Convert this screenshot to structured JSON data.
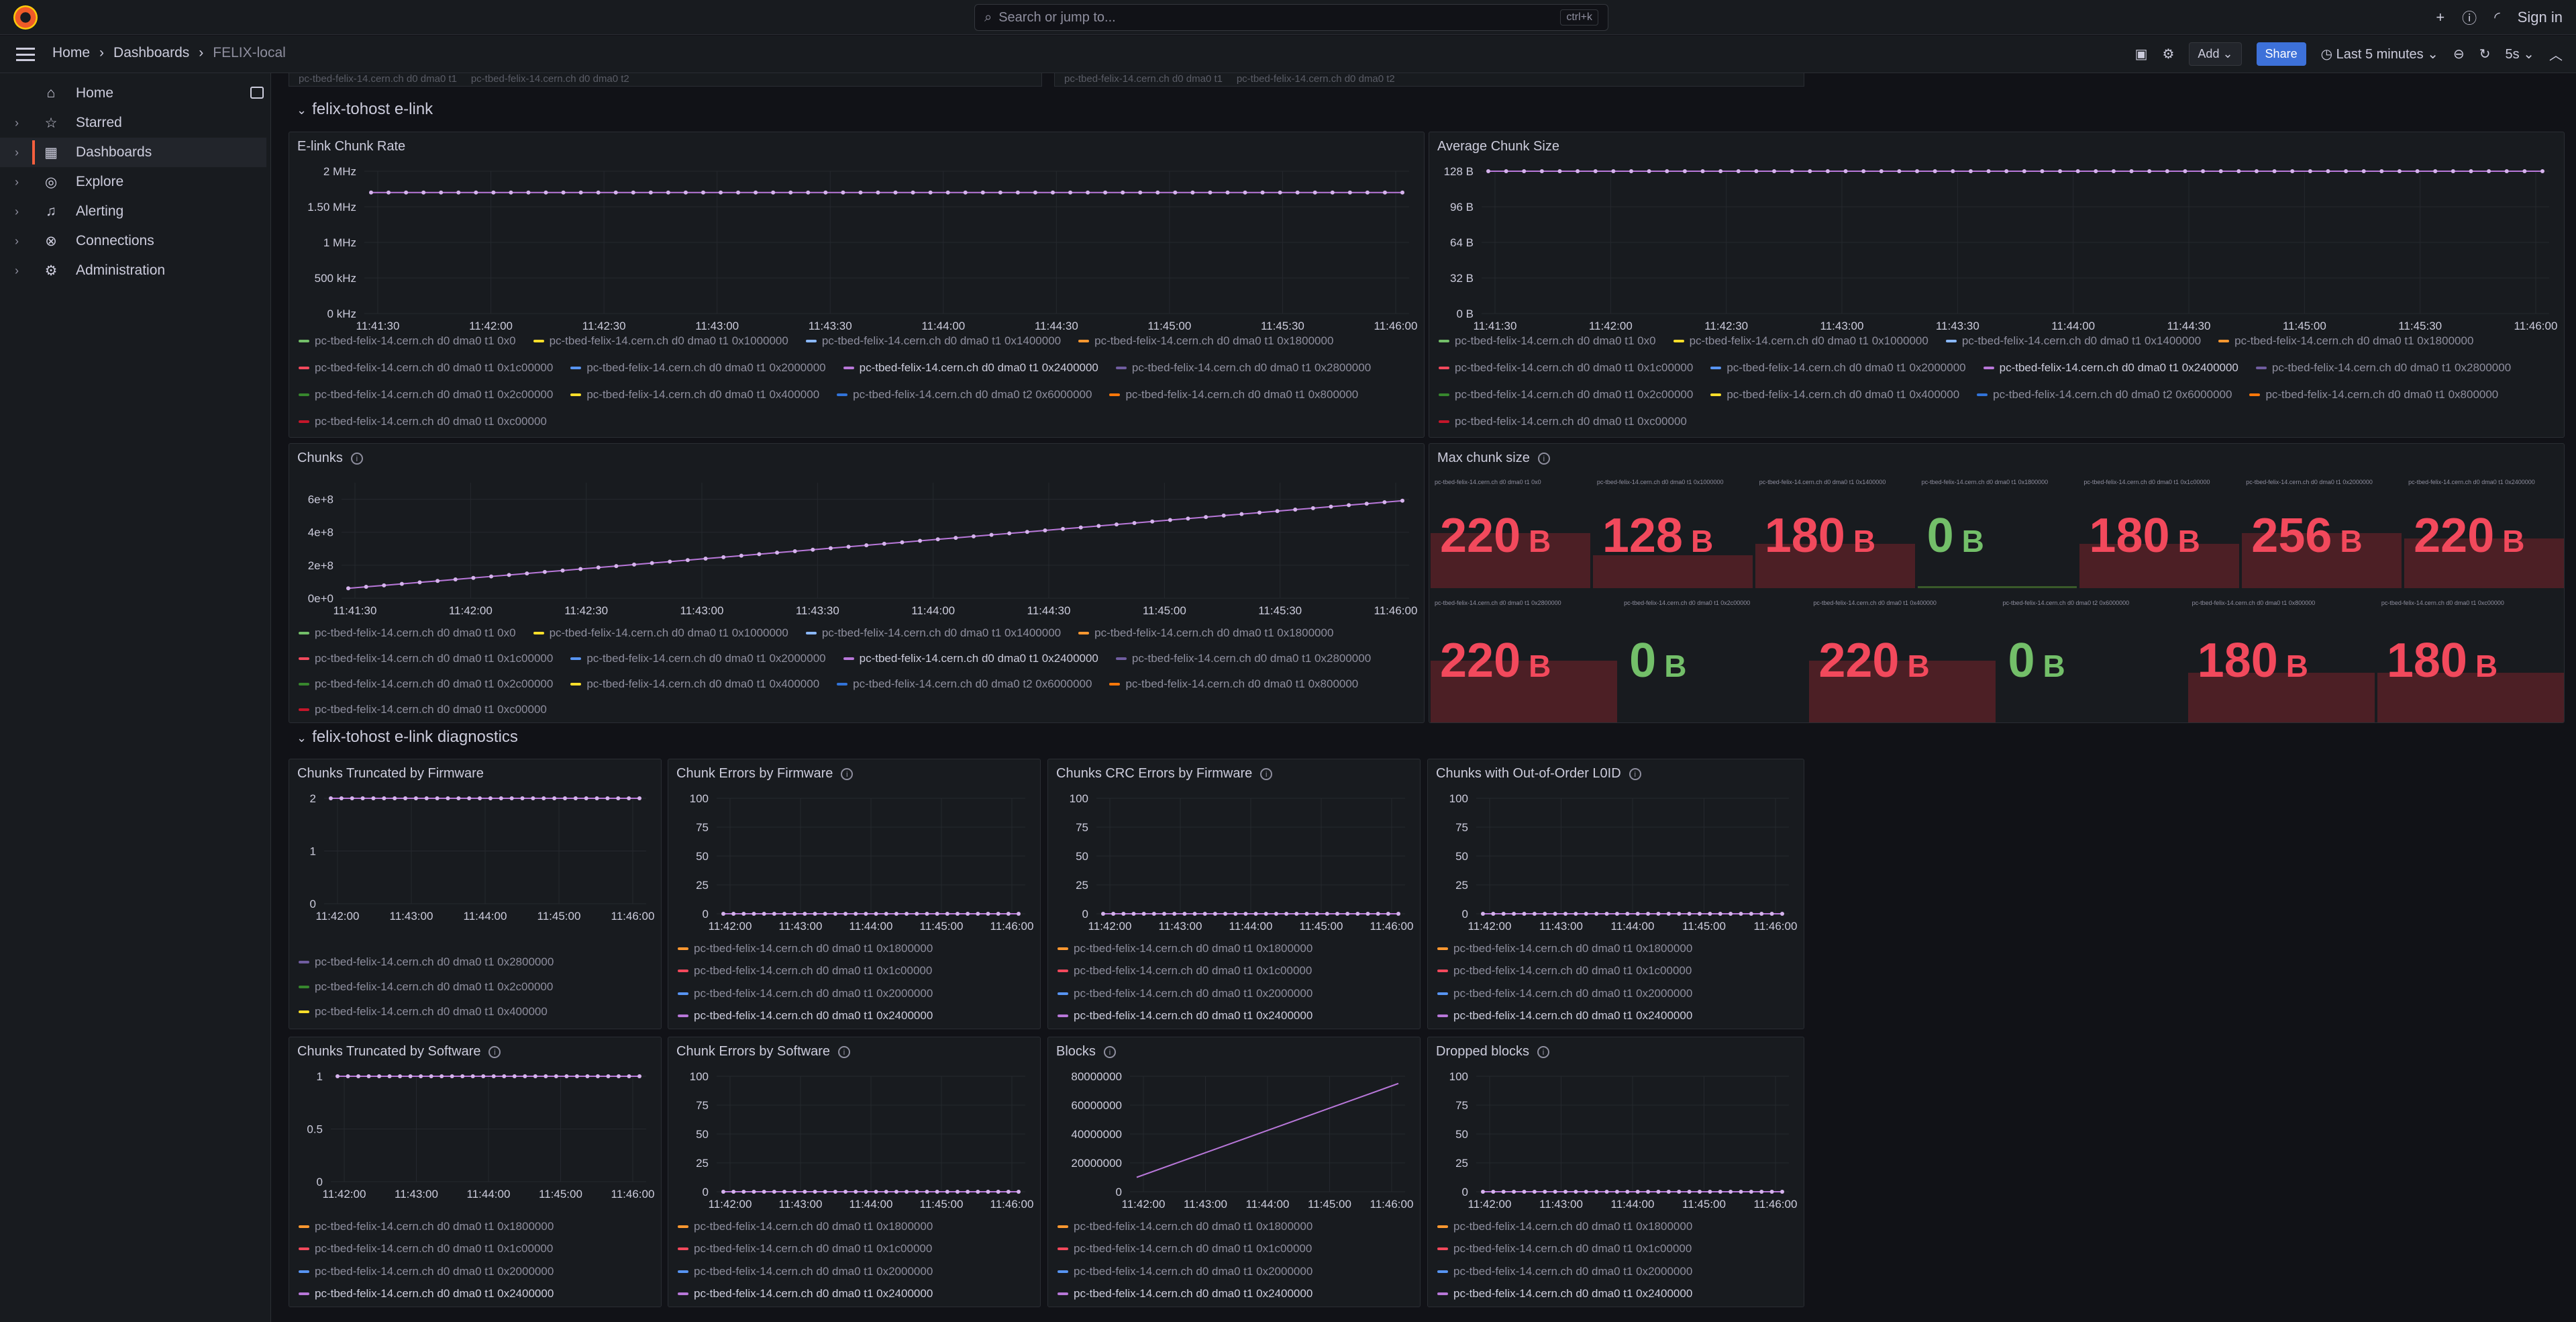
{
  "app": {
    "search_placeholder": "Search or jump to...",
    "search_shortcut": "ctrl+k",
    "plus": "+",
    "sign_in": "Sign in"
  },
  "breadcrumb": [
    "Home",
    "Dashboards",
    "FELIX-local"
  ],
  "nav": {
    "add": "Add",
    "share": "Share",
    "time_range": "Last 5 minutes",
    "refresh": "5s"
  },
  "sidebar": [
    {
      "label": "Home",
      "icon": "home-icon",
      "glyph": "⌂",
      "chev": false,
      "active": false
    },
    {
      "label": "Starred",
      "icon": "star-icon",
      "glyph": "☆",
      "chev": true,
      "active": false
    },
    {
      "label": "Dashboards",
      "icon": "dashboards-icon",
      "glyph": "▦",
      "chev": true,
      "active": true
    },
    {
      "label": "Explore",
      "icon": "compass-icon",
      "glyph": "◎",
      "chev": true,
      "active": false
    },
    {
      "label": "Alerting",
      "icon": "bell-icon",
      "glyph": "♫",
      "chev": true,
      "active": false
    },
    {
      "label": "Connections",
      "icon": "connections-icon",
      "glyph": "⊗",
      "chev": true,
      "active": false
    },
    {
      "label": "Administration",
      "icon": "gear-icon",
      "glyph": "⚙",
      "chev": true,
      "active": false
    }
  ],
  "top_stub": [
    "pc-tbed-felix-14.cern.ch d0 dma0 t1",
    "pc-tbed-felix-14.cern.ch d0 dma0 t2"
  ],
  "rows": {
    "elink": "felix-tohost e-link",
    "diag": "felix-tohost e-link diagnostics"
  },
  "colors": [
    "#73bf69",
    "#fade2a",
    "#8ab8ff",
    "#ff9830",
    "#f2495c",
    "#5794f2",
    "#b877d9",
    "#705da0",
    "#37872d",
    "#fade2a",
    "#3274d9",
    "#ff780a",
    "#c4162a",
    "#c8a1f2"
  ],
  "legend_full": [
    {
      "label": "pc-tbed-felix-14.cern.ch d0 dma0 t1 0x0",
      "color": "#73bf69",
      "hl": false
    },
    {
      "label": "pc-tbed-felix-14.cern.ch d0 dma0 t1 0x1000000",
      "color": "#fade2a",
      "hl": false
    },
    {
      "label": "pc-tbed-felix-14.cern.ch d0 dma0 t1 0x1400000",
      "color": "#8ab8ff",
      "hl": false
    },
    {
      "label": "pc-tbed-felix-14.cern.ch d0 dma0 t1 0x1800000",
      "color": "#ff9830",
      "hl": false
    },
    {
      "label": "pc-tbed-felix-14.cern.ch d0 dma0 t1 0x1c00000",
      "color": "#f2495c",
      "hl": false
    },
    {
      "label": "pc-tbed-felix-14.cern.ch d0 dma0 t1 0x2000000",
      "color": "#5794f2",
      "hl": false
    },
    {
      "label": "pc-tbed-felix-14.cern.ch d0 dma0 t1 0x2400000",
      "color": "#b877d9",
      "hl": true
    },
    {
      "label": "pc-tbed-felix-14.cern.ch d0 dma0 t1 0x2800000",
      "color": "#705da0",
      "hl": false
    },
    {
      "label": "pc-tbed-felix-14.cern.ch d0 dma0 t1 0x2c00000",
      "color": "#37872d",
      "hl": false
    },
    {
      "label": "pc-tbed-felix-14.cern.ch d0 dma0 t1 0x400000",
      "color": "#fade2a",
      "hl": false
    },
    {
      "label": "pc-tbed-felix-14.cern.ch d0 dma0 t2 0x6000000",
      "color": "#3274d9",
      "hl": false
    },
    {
      "label": "pc-tbed-felix-14.cern.ch d0 dma0 t1 0x800000",
      "color": "#ff780a",
      "hl": false
    },
    {
      "label": "pc-tbed-felix-14.cern.ch d0 dma0 t1 0xc00000",
      "color": "#c4162a",
      "hl": false
    }
  ],
  "legend_diag": [
    {
      "label": "pc-tbed-felix-14.cern.ch d0 dma0 t1 0x1800000",
      "color": "#ff9830",
      "hl": false
    },
    {
      "label": "pc-tbed-felix-14.cern.ch d0 dma0 t1 0x1c00000",
      "color": "#f2495c",
      "hl": false
    },
    {
      "label": "pc-tbed-felix-14.cern.ch d0 dma0 t1 0x2000000",
      "color": "#5794f2",
      "hl": false
    },
    {
      "label": "pc-tbed-felix-14.cern.ch d0 dma0 t1 0x2400000",
      "color": "#b877d9",
      "hl": true
    }
  ],
  "legend_trunc_fw": [
    {
      "label": "pc-tbed-felix-14.cern.ch d0 dma0 t1 0x2800000",
      "color": "#705da0",
      "hl": false
    },
    {
      "label": "pc-tbed-felix-14.cern.ch d0 dma0 t1 0x2c00000",
      "color": "#37872d",
      "hl": false
    },
    {
      "label": "pc-tbed-felix-14.cern.ch d0 dma0 t1 0x400000",
      "color": "#fade2a",
      "hl": false
    }
  ],
  "max_chunk": {
    "title": "Max chunk size",
    "row1": [
      {
        "label": "pc-tbed-felix-14.cern.ch d0 dma0 t1 0x0",
        "value": "220",
        "unit": "B",
        "status": "red",
        "fill": 0.5
      },
      {
        "label": "pc-tbed-felix-14.cern.ch d0 dma0 t1 0x1000000",
        "value": "128",
        "unit": "B",
        "status": "red",
        "fill": 0.3
      },
      {
        "label": "pc-tbed-felix-14.cern.ch d0 dma0 t1 0x1400000",
        "value": "180",
        "unit": "B",
        "status": "red",
        "fill": 0.4
      },
      {
        "label": "pc-tbed-felix-14.cern.ch d0 dma0 t1 0x1800000",
        "value": "0",
        "unit": "B",
        "status": "green",
        "fill": 0.02
      },
      {
        "label": "pc-tbed-felix-14.cern.ch d0 dma0 t1 0x1c00000",
        "value": "180",
        "unit": "B",
        "status": "red",
        "fill": 0.4
      },
      {
        "label": "pc-tbed-felix-14.cern.ch d0 dma0 t1 0x2000000",
        "value": "256",
        "unit": "B",
        "status": "red",
        "fill": 0.5
      },
      {
        "label": "pc-tbed-felix-14.cern.ch d0 dma0 t1 0x2400000",
        "value": "220",
        "unit": "B",
        "status": "red",
        "fill": 0.45
      }
    ],
    "row2": [
      {
        "label": "pc-tbed-felix-14.cern.ch d0 dma0 t1 0x2800000",
        "value": "220",
        "unit": "B",
        "status": "red",
        "fill": 0.5
      },
      {
        "label": "pc-tbed-felix-14.cern.ch d0 dma0 t1 0x2c00000",
        "value": "0",
        "unit": "B",
        "status": "green",
        "fill": 0.0
      },
      {
        "label": "pc-tbed-felix-14.cern.ch d0 dma0 t1 0x400000",
        "value": "220",
        "unit": "B",
        "status": "red",
        "fill": 0.5
      },
      {
        "label": "pc-tbed-felix-14.cern.ch d0 dma0 t2 0x6000000",
        "value": "0",
        "unit": "B",
        "status": "green",
        "fill": 0.0
      },
      {
        "label": "pc-tbed-felix-14.cern.ch d0 dma0 t1 0x800000",
        "value": "180",
        "unit": "B",
        "status": "red",
        "fill": 0.4
      },
      {
        "label": "pc-tbed-felix-14.cern.ch d0 dma0 t1 0xc00000",
        "value": "180",
        "unit": "B",
        "status": "red",
        "fill": 0.4
      }
    ]
  },
  "chart_data": [
    {
      "id": "elink_rate",
      "title": "E-link Chunk Rate",
      "type": "line",
      "ytick": [
        "0 kHz",
        "500 kHz",
        "1 MHz",
        "1.50 MHz",
        "2 MHz"
      ],
      "ylim": [
        0,
        2000000
      ],
      "ytick_values": [
        0,
        500000,
        1000000,
        1500000,
        2000000
      ],
      "xtick": [
        "11:41:30",
        "11:42:00",
        "11:42:30",
        "11:43:00",
        "11:43:30",
        "11:44:00",
        "11:44:30",
        "11:45:00",
        "11:45:30",
        "11:46:00"
      ],
      "series": [
        {
          "color": "#b877d9",
          "values": [
            1700000,
            1700000,
            1700000,
            1700000,
            1700000,
            1700000,
            1700000,
            1700000,
            1700000,
            1700000,
            1700000,
            1700000,
            1700000,
            1700000,
            1700000,
            1700000,
            1700000,
            1700000,
            1700000,
            1700000,
            1700000,
            1700000,
            1700000,
            1700000,
            1700000,
            1700000,
            1700000,
            1700000,
            1700000,
            1700000,
            1700000,
            1700000,
            1700000,
            1700000,
            1700000,
            1700000,
            1700000,
            1700000,
            1700000,
            1700000,
            1700000,
            1700000,
            1700000,
            1700000,
            1700000,
            1700000,
            1700000,
            1700000,
            1700000,
            1700000,
            1700000,
            1700000,
            1700000,
            1700000,
            1700000,
            1700000,
            1700000,
            1700000,
            1700000,
            1700000
          ]
        }
      ]
    },
    {
      "id": "avg_chunk",
      "title": "Average Chunk Size",
      "type": "line",
      "ytick": [
        "0 B",
        "32 B",
        "64 B",
        "96 B",
        "128 B"
      ],
      "ylim": [
        0,
        128
      ],
      "ytick_values": [
        0,
        32,
        64,
        96,
        128
      ],
      "xtick": [
        "11:41:30",
        "11:42:00",
        "11:42:30",
        "11:43:00",
        "11:43:30",
        "11:44:00",
        "11:44:30",
        "11:45:00",
        "11:45:30",
        "11:46:00"
      ],
      "series": [
        {
          "color": "#b877d9",
          "values": [
            128,
            128,
            128,
            128,
            128,
            128,
            128,
            128,
            128,
            128,
            128,
            128,
            128,
            128,
            128,
            128,
            128,
            128,
            128,
            128,
            128,
            128,
            128,
            128,
            128,
            128,
            128,
            128,
            128,
            128,
            128,
            128,
            128,
            128,
            128,
            128,
            128,
            128,
            128,
            128,
            128,
            128,
            128,
            128,
            128,
            128,
            128,
            128,
            128,
            128,
            128,
            128,
            128,
            128,
            128,
            128,
            128,
            128,
            128,
            128
          ]
        }
      ]
    },
    {
      "id": "chunks",
      "title": "Chunks",
      "type": "line",
      "ytick": [
        "0e+0",
        "2e+8",
        "4e+8",
        "6e+8"
      ],
      "ylim": [
        0,
        700000000
      ],
      "ytick_values": [
        0,
        200000000,
        400000000,
        600000000
      ],
      "xtick": [
        "11:41:30",
        "11:42:00",
        "11:42:30",
        "11:43:00",
        "11:43:30",
        "11:44:00",
        "11:44:30",
        "11:45:00",
        "11:45:30",
        "11:46:00"
      ],
      "series": [
        {
          "color": "#b877d9",
          "values": [
            60000000,
            69000000,
            78000000,
            87000000,
            96000000,
            105000000,
            114000000,
            123000000,
            132000000,
            141000000,
            150000000,
            159000000,
            168000000,
            177000000,
            186000000,
            195000000,
            204000000,
            213000000,
            222000000,
            231000000,
            240000000,
            249000000,
            258000000,
            267000000,
            276000000,
            285000000,
            294000000,
            303000000,
            312000000,
            321000000,
            330000000,
            339000000,
            348000000,
            357000000,
            366000000,
            375000000,
            384000000,
            393000000,
            402000000,
            411000000,
            420000000,
            429000000,
            438000000,
            447000000,
            456000000,
            465000000,
            474000000,
            483000000,
            492000000,
            501000000,
            510000000,
            519000000,
            528000000,
            537000000,
            546000000,
            555000000,
            564000000,
            573000000,
            582000000,
            591000000
          ]
        }
      ]
    },
    {
      "id": "trunc_fw",
      "title": "Chunks Truncated by Firmware",
      "type": "line",
      "ytick": [
        "0",
        "1",
        "2"
      ],
      "ylim": [
        0,
        2
      ],
      "ytick_values": [
        0,
        1,
        2
      ],
      "xtick": [
        "11:42:00",
        "11:43:00",
        "11:44:00",
        "11:45:00",
        "11:46:00"
      ],
      "series": [
        {
          "color": "#b877d9",
          "values": [
            2,
            2,
            2,
            2,
            2,
            2,
            2,
            2,
            2,
            2,
            2,
            2,
            2,
            2,
            2,
            2,
            2,
            2,
            2,
            2,
            2,
            2,
            2,
            2,
            2,
            2,
            2,
            2,
            2,
            2
          ]
        }
      ]
    },
    {
      "id": "err_fw",
      "title": "Chunk Errors by Firmware",
      "type": "line",
      "ytick": [
        "0",
        "25",
        "50",
        "75",
        "100"
      ],
      "ylim": [
        0,
        100
      ],
      "ytick_values": [
        0,
        25,
        50,
        75,
        100
      ],
      "xtick": [
        "11:42:00",
        "11:43:00",
        "11:44:00",
        "11:45:00",
        "11:46:00"
      ],
      "series": [
        {
          "color": "#b877d9",
          "values": [
            0,
            0,
            0,
            0,
            0,
            0,
            0,
            0,
            0,
            0,
            0,
            0,
            0,
            0,
            0,
            0,
            0,
            0,
            0,
            0,
            0,
            0,
            0,
            0,
            0,
            0,
            0,
            0,
            0,
            0
          ]
        }
      ]
    },
    {
      "id": "crc_fw",
      "title": "Chunks CRC Errors by Firmware",
      "type": "line",
      "ytick": [
        "0",
        "25",
        "50",
        "75",
        "100"
      ],
      "ylim": [
        0,
        100
      ],
      "ytick_values": [
        0,
        25,
        50,
        75,
        100
      ],
      "xtick": [
        "11:42:00",
        "11:43:00",
        "11:44:00",
        "11:45:00",
        "11:46:00"
      ],
      "series": [
        {
          "color": "#b877d9",
          "values": [
            0,
            0,
            0,
            0,
            0,
            0,
            0,
            0,
            0,
            0,
            0,
            0,
            0,
            0,
            0,
            0,
            0,
            0,
            0,
            0,
            0,
            0,
            0,
            0,
            0,
            0,
            0,
            0,
            0,
            0
          ]
        }
      ]
    },
    {
      "id": "ooo",
      "title": "Chunks with Out-of-Order L0ID",
      "type": "line",
      "ytick": [
        "0",
        "25",
        "50",
        "75",
        "100"
      ],
      "ylim": [
        0,
        100
      ],
      "ytick_values": [
        0,
        25,
        50,
        75,
        100
      ],
      "xtick": [
        "11:42:00",
        "11:43:00",
        "11:44:00",
        "11:45:00",
        "11:46:00"
      ],
      "series": [
        {
          "color": "#b877d9",
          "values": [
            0,
            0,
            0,
            0,
            0,
            0,
            0,
            0,
            0,
            0,
            0,
            0,
            0,
            0,
            0,
            0,
            0,
            0,
            0,
            0,
            0,
            0,
            0,
            0,
            0,
            0,
            0,
            0,
            0,
            0
          ]
        }
      ]
    },
    {
      "id": "trunc_sw",
      "title": "Chunks Truncated by Software",
      "type": "line",
      "ytick": [
        "0",
        "0.5",
        "1"
      ],
      "ylim": [
        0,
        1
      ],
      "ytick_values": [
        0,
        0.5,
        1
      ],
      "xtick": [
        "11:42:00",
        "11:43:00",
        "11:44:00",
        "11:45:00",
        "11:46:00"
      ],
      "series": [
        {
          "color": "#b877d9",
          "values": [
            1,
            1,
            1,
            1,
            1,
            1,
            1,
            1,
            1,
            1,
            1,
            1,
            1,
            1,
            1,
            1,
            1,
            1,
            1,
            1,
            1,
            1,
            1,
            1,
            1,
            1,
            1,
            1,
            1,
            1
          ]
        }
      ]
    },
    {
      "id": "err_sw",
      "title": "Chunk Errors by Software",
      "type": "line",
      "ytick": [
        "0",
        "25",
        "50",
        "75",
        "100"
      ],
      "ylim": [
        0,
        100
      ],
      "ytick_values": [
        0,
        25,
        50,
        75,
        100
      ],
      "xtick": [
        "11:42:00",
        "11:43:00",
        "11:44:00",
        "11:45:00",
        "11:46:00"
      ],
      "series": [
        {
          "color": "#b877d9",
          "values": [
            0,
            0,
            0,
            0,
            0,
            0,
            0,
            0,
            0,
            0,
            0,
            0,
            0,
            0,
            0,
            0,
            0,
            0,
            0,
            0,
            0,
            0,
            0,
            0,
            0,
            0,
            0,
            0,
            0,
            0
          ]
        }
      ]
    },
    {
      "id": "blocks",
      "title": "Blocks",
      "type": "line",
      "ytick": [
        "0",
        "20000000",
        "40000000",
        "60000000",
        "80000000"
      ],
      "ylim": [
        0,
        80000000
      ],
      "ytick_values": [
        0,
        20000000,
        40000000,
        60000000,
        80000000
      ],
      "xtick": [
        "11:42:00",
        "11:43:00",
        "11:44:00",
        "11:45:00",
        "11:46:00"
      ],
      "series": [
        {
          "color": "#b877d9",
          "values": [
            10000000,
            75000000
          ]
        }
      ]
    },
    {
      "id": "dropped",
      "title": "Dropped blocks",
      "type": "line",
      "ytick": [
        "0",
        "25",
        "50",
        "75",
        "100"
      ],
      "ylim": [
        0,
        100
      ],
      "ytick_values": [
        0,
        25,
        50,
        75,
        100
      ],
      "xtick": [
        "11:42:00",
        "11:43:00",
        "11:44:00",
        "11:45:00",
        "11:46:00"
      ],
      "series": [
        {
          "color": "#b877d9",
          "values": [
            0,
            0,
            0,
            0,
            0,
            0,
            0,
            0,
            0,
            0,
            0,
            0,
            0,
            0,
            0,
            0,
            0,
            0,
            0,
            0,
            0,
            0,
            0,
            0,
            0,
            0,
            0,
            0,
            0,
            0
          ]
        }
      ]
    }
  ]
}
